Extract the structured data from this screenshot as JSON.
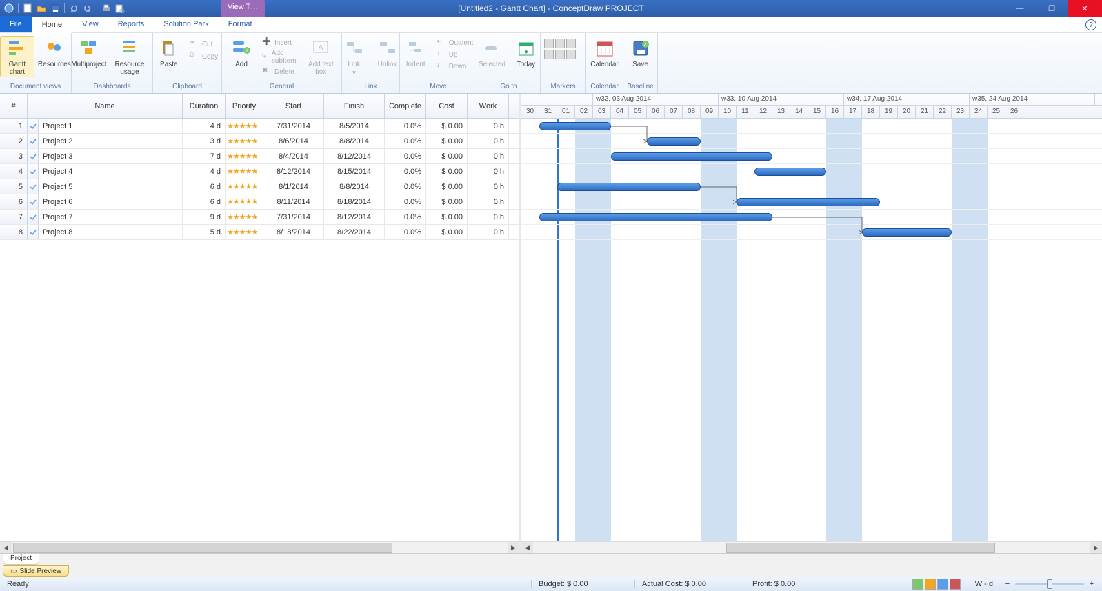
{
  "window": {
    "title": "[Untitled2 - Gantt Chart] - ConceptDraw PROJECT",
    "context_tab": "View T…",
    "file_tab": "File",
    "tabs": [
      "Home",
      "View",
      "Reports",
      "Solution Park",
      "Format"
    ],
    "active_tab": "Home"
  },
  "ribbon": {
    "groups": {
      "doc_views": {
        "label": "Document views",
        "gantt": "Gantt chart",
        "res": "Resources"
      },
      "dash": {
        "label": "Dashboards",
        "multi": "Multiproject",
        "usage": "Resource usage"
      },
      "clip": {
        "label": "Clipboard",
        "paste": "Paste",
        "cut": "Cut",
        "copy": "Copy"
      },
      "general": {
        "label": "General",
        "add": "Add",
        "insert": "Insert",
        "addsub": "Add subItem",
        "delete": "Delete",
        "addtext": "Add text box"
      },
      "link": {
        "label": "Link",
        "link": "Link",
        "unlink": "Unlink"
      },
      "move": {
        "label": "Move",
        "indent": "Indent",
        "outdent": "Outdent",
        "up": "Up",
        "down": "Down"
      },
      "goto": {
        "label": "Go to",
        "selected": "Selected",
        "today": "Today"
      },
      "markers": {
        "label": "Markers"
      },
      "cal": {
        "label": "Calendar",
        "cal": "Calendar"
      },
      "baseline": {
        "label": "Baseline",
        "save": "Save"
      }
    }
  },
  "grid": {
    "headers": {
      "num": "#",
      "name": "Name",
      "dur": "Duration",
      "pri": "Priority",
      "start": "Start",
      "finish": "Finish",
      "complete": "Complete",
      "cost": "Cost",
      "work": "Work"
    },
    "rows": [
      {
        "n": "1",
        "name": "Project 1",
        "dur": "4 d",
        "stars": 5,
        "start": "7/31/2014",
        "finish": "8/5/2014",
        "pct": "0.0%",
        "cost": "$ 0.00",
        "work": "0 h",
        "bar_start": 1,
        "bar_len": 4
      },
      {
        "n": "2",
        "name": "Project 2",
        "dur": "3 d",
        "stars": 5,
        "start": "8/6/2014",
        "finish": "8/8/2014",
        "pct": "0.0%",
        "cost": "$ 0.00",
        "work": "0 h",
        "bar_start": 7,
        "bar_len": 3
      },
      {
        "n": "3",
        "name": "Project 3",
        "dur": "7 d",
        "stars": 5,
        "start": "8/4/2014",
        "finish": "8/12/2014",
        "pct": "0.0%",
        "cost": "$ 0.00",
        "work": "0 h",
        "bar_start": 5,
        "bar_len": 9
      },
      {
        "n": "4",
        "name": "Project 4",
        "dur": "4 d",
        "stars": 5,
        "start": "8/12/2014",
        "finish": "8/15/2014",
        "pct": "0.0%",
        "cost": "$ 0.00",
        "work": "0 h",
        "bar_start": 13,
        "bar_len": 4
      },
      {
        "n": "5",
        "name": "Project 5",
        "dur": "6 d",
        "stars": 5,
        "start": "8/1/2014",
        "finish": "8/8/2014",
        "pct": "0.0%",
        "cost": "$ 0.00",
        "work": "0 h",
        "bar_start": 2,
        "bar_len": 8
      },
      {
        "n": "6",
        "name": "Project 6",
        "dur": "6 d",
        "stars": 5,
        "start": "8/11/2014",
        "finish": "8/18/2014",
        "pct": "0.0%",
        "cost": "$ 0.00",
        "work": "0 h",
        "bar_start": 12,
        "bar_len": 8
      },
      {
        "n": "7",
        "name": "Project 7",
        "dur": "9 d",
        "stars": 5,
        "start": "7/31/2014",
        "finish": "8/12/2014",
        "pct": "0.0%",
        "cost": "$ 0.00",
        "work": "0 h",
        "bar_start": 1,
        "bar_len": 13
      },
      {
        "n": "8",
        "name": "Project 8",
        "dur": "5 d",
        "stars": 5,
        "start": "8/18/2014",
        "finish": "8/22/2014",
        "pct": "0.0%",
        "cost": "$ 0.00",
        "work": "0 h",
        "bar_start": 19,
        "bar_len": 5
      }
    ]
  },
  "timeline": {
    "weeks": [
      {
        "label": "",
        "start": 0,
        "span": 4
      },
      {
        "label": "w32, 03 Aug 2014",
        "start": 4,
        "span": 7
      },
      {
        "label": "w33, 10 Aug 2014",
        "start": 11,
        "span": 7
      },
      {
        "label": "w34, 17 Aug 2014",
        "start": 18,
        "span": 7
      },
      {
        "label": "w35, 24 Aug 2014",
        "start": 25,
        "span": 7
      }
    ],
    "days": [
      "30",
      "31",
      "01",
      "02",
      "03",
      "04",
      "05",
      "06",
      "07",
      "08",
      "09",
      "10",
      "11",
      "12",
      "13",
      "14",
      "15",
      "16",
      "17",
      "18",
      "19",
      "20",
      "21",
      "22",
      "23",
      "24",
      "25",
      "26"
    ],
    "weekends": [
      3,
      4,
      10,
      11,
      17,
      18,
      24,
      25
    ],
    "day_width": 26
  },
  "links": [
    {
      "from": 0,
      "to": 1
    },
    {
      "from": 4,
      "to": 5
    },
    {
      "from": 6,
      "to": 7
    }
  ],
  "tabs_bottom": {
    "project": "Project",
    "preview": "Slide Preview"
  },
  "status": {
    "ready": "Ready",
    "budget": "Budget: $ 0.00",
    "actual": "Actual Cost: $ 0.00",
    "profit": "Profit: $ 0.00",
    "zoom": "W - d"
  }
}
